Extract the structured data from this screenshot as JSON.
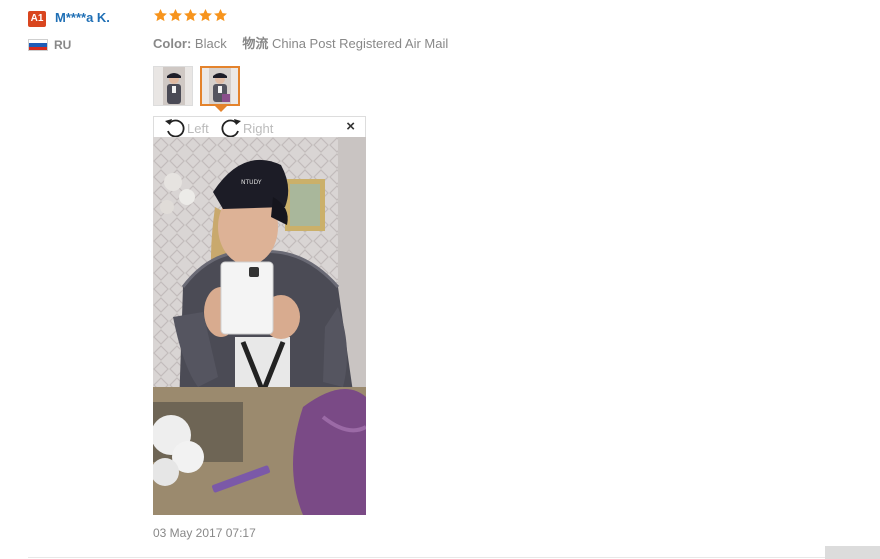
{
  "reviewer": {
    "level_badge": "A1",
    "name": "M****a K.",
    "country_code": "RU",
    "flag_icon": "russia-flag-icon"
  },
  "review": {
    "rating": 5,
    "rating_max": 5,
    "star_color": "#f7941d",
    "color_label": "Color:",
    "color_value": "Black",
    "shipping_label": "物流",
    "shipping_value": "China Post Registered Air Mail",
    "date": "03 May 2017 07:17"
  },
  "gallery": {
    "thumbnail_count": 2,
    "selected_index": 1,
    "accent_color": "#e4832c"
  },
  "viewer": {
    "rotate_left_label": "Left",
    "rotate_right_label": "Right",
    "close_label": "×",
    "rotate_left_icon": "rotate-left-icon",
    "rotate_right_icon": "rotate-right-icon",
    "close_icon": "close-icon"
  },
  "colors": {
    "username": "#1f6fb5",
    "badge": "#d9461f"
  }
}
